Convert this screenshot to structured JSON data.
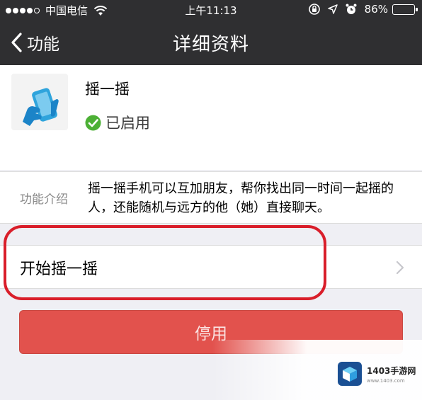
{
  "status_bar": {
    "carrier": "中国电信",
    "time": "上午11:13",
    "battery": "86%",
    "battery_fraction": 0.86,
    "icons": [
      "signal-dots-icon",
      "wifi-icon",
      "orientation-lock-icon",
      "location-arrow-icon",
      "alarm-clock-icon",
      "battery-icon"
    ]
  },
  "nav": {
    "back_label": "功能",
    "title": "详细资料"
  },
  "feature": {
    "name": "摇一摇",
    "status": "已启用",
    "status_color": "#4cb035",
    "icon": "shake-phone-icon"
  },
  "intro": {
    "label": "功能介绍",
    "text": "摇一摇手机可以互加朋友，帮你找出同一时间一起摇的人，还能随机与远方的他（她）直接聊天。"
  },
  "actions": {
    "start_label": "开始摇一摇",
    "disable_label": "停用"
  },
  "colors": {
    "nav_background": "#2f2f31",
    "disable_button": "#e2524d",
    "highlight_ring": "#d91e2a",
    "page_background": "#efeff4"
  },
  "watermark": {
    "name": "1403手游网",
    "url": "www.1403.com"
  }
}
